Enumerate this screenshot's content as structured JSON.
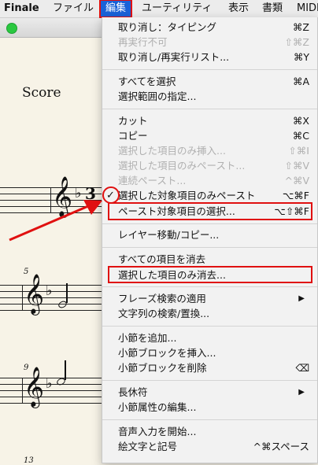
{
  "menubar": {
    "app": "Finale",
    "items": [
      "ファイル",
      "編集",
      "ユーティリティ",
      "表示",
      "書類",
      "MIDI"
    ]
  },
  "score": {
    "title": "Score",
    "time_signature": "3",
    "measure_numbers": [
      "5",
      "9",
      "13"
    ]
  },
  "edit_menu": {
    "items": [
      {
        "label": "取り消し：タイピング",
        "shortcut": "⌘Z",
        "enabled": true
      },
      {
        "label": "再実行不可",
        "shortcut": "⇧⌘Z",
        "enabled": false
      },
      {
        "label": "取り消し/再実行リスト...",
        "shortcut": "⌘Y",
        "enabled": true
      },
      {
        "label": "すべてを選択",
        "shortcut": "⌘A",
        "enabled": true
      },
      {
        "label": "選択範囲の指定...",
        "shortcut": "",
        "enabled": true
      },
      {
        "label": "カット",
        "shortcut": "⌘X",
        "enabled": true
      },
      {
        "label": "コピー",
        "shortcut": "⌘C",
        "enabled": true
      },
      {
        "label": "選択した項目のみ挿入...",
        "shortcut": "⇧⌘I",
        "enabled": false
      },
      {
        "label": "選択した項目のみペースト...",
        "shortcut": "⇧⌘V",
        "enabled": false
      },
      {
        "label": "連続ペースト...",
        "shortcut": "^⌘V",
        "enabled": false
      },
      {
        "label": "選択した対象項目のみペースト",
        "shortcut": "⌥⌘F",
        "enabled": true,
        "checked": true
      },
      {
        "label": "ペースト対象項目の選択...",
        "shortcut": "⌥⇧⌘F",
        "enabled": true
      },
      {
        "label": "レイヤー移動/コピー...",
        "shortcut": "",
        "enabled": true
      },
      {
        "label": "すべての項目を消去",
        "shortcut": "",
        "enabled": true
      },
      {
        "label": "選択した項目のみ消去...",
        "shortcut": "",
        "enabled": true
      },
      {
        "label": "フレーズ検索の適用",
        "shortcut": "",
        "enabled": true,
        "submenu": true
      },
      {
        "label": "文字列の検索/置換...",
        "shortcut": "",
        "enabled": true
      },
      {
        "label": "小節を追加...",
        "shortcut": "",
        "enabled": true
      },
      {
        "label": "小節ブロックを挿入...",
        "shortcut": "",
        "enabled": true
      },
      {
        "label": "小節ブロックを削除",
        "shortcut": "⌫",
        "enabled": true
      },
      {
        "label": "長休符",
        "shortcut": "",
        "enabled": true,
        "submenu": true
      },
      {
        "label": "小節属性の編集...",
        "shortcut": "",
        "enabled": true
      },
      {
        "label": "音声入力を開始...",
        "shortcut": "",
        "enabled": true
      },
      {
        "label": "絵文字と記号",
        "shortcut": "^⌘スペース",
        "enabled": true
      }
    ]
  },
  "icons": {
    "check": "✓",
    "submenu": "▶",
    "treble_clef": "𝄞",
    "flat": "♭"
  },
  "colors": {
    "menubar_highlight": "#1a62d8",
    "annotation_red": "#e01010",
    "paper": "#f7f3e7"
  }
}
